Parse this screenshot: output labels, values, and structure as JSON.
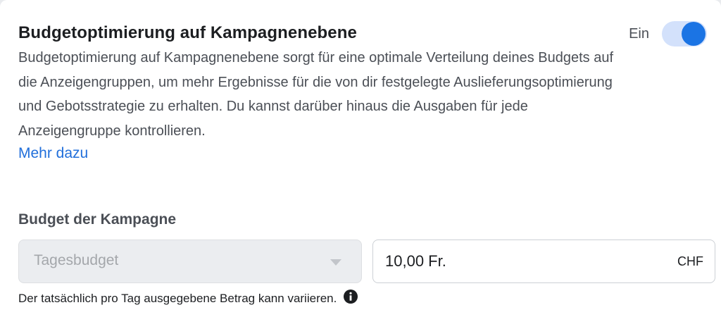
{
  "section": {
    "title": "Budgetoptimierung auf Kampagnenebene",
    "toggle_label": "Ein",
    "toggle_state": "on",
    "description": "Budgetoptimierung auf Kampagnenebene sorgt für eine optimale Verteilung deines Budgets auf die Anzeigengruppen, um mehr Ergebnisse für die von dir festgelegte Auslieferungsoptimierung und Gebotsstrategie zu erhalten. Du kannst darüber hinaus die Ausgaben für jede Anzeigengruppe kontrollieren.",
    "more_link": "Mehr dazu"
  },
  "budget": {
    "heading": "Budget der Kampagne",
    "type_selected": "Tagesbudget",
    "amount_value": "10,00 Fr.",
    "currency": "CHF",
    "hint": "Der tatsächlich pro Tag ausgegebene Betrag kann variieren.",
    "info_icon": "info-icon"
  },
  "colors": {
    "accent": "#1b74e4",
    "toggle_track": "#d3e1fb",
    "link": "#216fdb",
    "disabled_bg": "#ebedf0"
  }
}
